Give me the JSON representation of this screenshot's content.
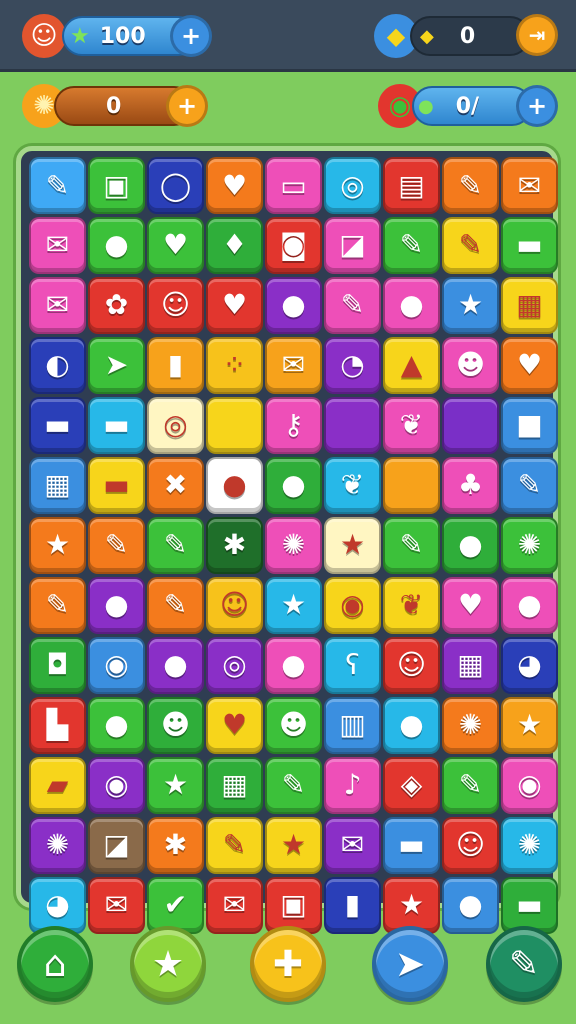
{
  "hud": {
    "coins_value": "100",
    "gems_value": "0",
    "energy_value": "0",
    "moves_value": "0/",
    "plus_label": "+"
  },
  "colors": {
    "topbar": "#3a4a5c",
    "background": "#7fcc5e",
    "board": "#2f3d52"
  },
  "bottom_bar": [
    {
      "name": "home-button",
      "icon": "home-icon",
      "glyph": "⌂",
      "color": "#2fae3a"
    },
    {
      "name": "star-button",
      "icon": "star-icon",
      "glyph": "★",
      "color": "#8fd63c"
    },
    {
      "name": "puzzle-button",
      "icon": "puzzle-icon",
      "glyph": "✚",
      "color": "#f7c21b"
    },
    {
      "name": "play-button",
      "icon": "play-icon",
      "glyph": "➤",
      "color": "#3b8fe0"
    },
    {
      "name": "edit-button",
      "icon": "pencil-icon",
      "glyph": "✎",
      "color": "#1f8f63"
    }
  ],
  "board": {
    "rows": [
      [
        [
          "#3fa9f5",
          "pencil-icon",
          "✎"
        ],
        [
          "#3cc13a",
          "bag-icon",
          "▣"
        ],
        [
          "#2a3fb8",
          "chat-icon",
          "◯"
        ],
        [
          "#f47a1c",
          "heart-icon",
          "♥"
        ],
        [
          "#ee4fb8",
          "card-icon",
          "▭"
        ],
        [
          "#27b8e8",
          "ring-icon",
          "◎"
        ],
        [
          "#e2362e",
          "window-icon",
          "▤"
        ],
        [
          "#f47a1c",
          "pencil-icon",
          "✎"
        ],
        [
          "#f47a1c",
          "mail-icon",
          "✉"
        ]
      ],
      [
        [
          "#ee4fb8",
          "mail-icon",
          "✉"
        ],
        [
          "#3cc13a",
          "berry-icon",
          "●"
        ],
        [
          "#3cc13a",
          "heart-icon",
          "♥"
        ],
        [
          "#2fae3a",
          "drop-icon",
          "♦"
        ],
        [
          "#e2362e",
          "camera-icon",
          "◙"
        ],
        [
          "#ee4fb8",
          "note-icon",
          "◪"
        ],
        [
          "#3cc13a",
          "pencil-icon",
          "✎"
        ],
        [
          "#f7d51b",
          "pencil-icon",
          "✎"
        ],
        [
          "#3cc13a",
          "book-icon",
          "▬"
        ]
      ],
      [
        [
          "#ee4fb8",
          "mail-icon",
          "✉"
        ],
        [
          "#e2362e",
          "flower-icon",
          "✿"
        ],
        [
          "#e2362e",
          "face-icon",
          "☺"
        ],
        [
          "#e2362e",
          "heart-icon",
          "♥"
        ],
        [
          "#8a2fc7",
          "fish-icon",
          "●"
        ],
        [
          "#ee4fb8",
          "brush-icon",
          "✎"
        ],
        [
          "#ee4fb8",
          "balloon-icon",
          "●"
        ],
        [
          "#3b8fe0",
          "star-icon",
          "★"
        ],
        [
          "#f7d51b",
          "ticket-icon",
          "▦"
        ]
      ],
      [
        [
          "#2a3fb8",
          "ball-icon",
          "◐"
        ],
        [
          "#3cc13a",
          "bird-icon",
          "➤"
        ],
        [
          "#f7a21b",
          "bag-icon",
          "▮"
        ],
        [
          "#f7c21b",
          "cookie-icon",
          "⁘"
        ],
        [
          "#f7a21b",
          "envelope-icon",
          "✉"
        ],
        [
          "#8a2fc7",
          "chat-icon",
          "◔"
        ],
        [
          "#f7d51b",
          "bottle-icon",
          "▲"
        ],
        [
          "#ee4fb8",
          "monster-icon",
          "☻"
        ],
        [
          "#f47a1c",
          "heart-icon",
          "♥"
        ]
      ],
      [
        [
          "#2a3fb8",
          "card-icon",
          "▬"
        ],
        [
          "#27b8e8",
          "card-icon",
          "▬"
        ],
        [
          "#fff6c2",
          "camera-icon",
          "◎"
        ],
        [
          "#f7d51b",
          "blank-icon",
          ""
        ],
        [
          "#ee4fb8",
          "key-icon",
          "⚷"
        ],
        [
          "#8a2fc7",
          "blank-icon",
          ""
        ],
        [
          "#ee4fb8",
          "leaf-icon",
          "❦"
        ],
        [
          "#7a2fc7",
          "blank-icon",
          ""
        ],
        [
          "#3b8fe0",
          "square-icon",
          "■"
        ]
      ],
      [
        [
          "#3b8fe0",
          "panel-icon",
          "▦"
        ],
        [
          "#f7d51b",
          "card-icon",
          "▬"
        ],
        [
          "#f47a1c",
          "bandage-icon",
          "✖"
        ],
        [
          "#ffffff",
          "fish-icon",
          "●"
        ],
        [
          "#2fae3a",
          "berry-icon",
          "●"
        ],
        [
          "#27b8e8",
          "leaf-icon",
          "❦"
        ],
        [
          "#f7a21b",
          "blank-icon",
          ""
        ],
        [
          "#ee4fb8",
          "sprout-icon",
          "♣"
        ],
        [
          "#3b8fe0",
          "pencil-icon",
          "✎"
        ]
      ],
      [
        [
          "#f47a1c",
          "star-icon",
          "★"
        ],
        [
          "#f47a1c",
          "pencil-icon",
          "✎"
        ],
        [
          "#3cc13a",
          "brush-icon",
          "✎"
        ],
        [
          "#1f6f2a",
          "bug-icon",
          "✱"
        ],
        [
          "#ee4fb8",
          "gear-icon",
          "✺"
        ],
        [
          "#fff6c2",
          "star-icon",
          "★"
        ],
        [
          "#3cc13a",
          "pencil-icon",
          "✎"
        ],
        [
          "#2fae3a",
          "berry-icon",
          "●"
        ],
        [
          "#3cc13a",
          "gear-icon",
          "✺"
        ]
      ],
      [
        [
          "#f47a1c",
          "pencil-icon",
          "✎"
        ],
        [
          "#8a2fc7",
          "apple-icon",
          "●"
        ],
        [
          "#f47a1c",
          "pencil-icon",
          "✎"
        ],
        [
          "#f7c21b",
          "face-icon",
          "☺"
        ],
        [
          "#27b8e8",
          "star-icon",
          "★"
        ],
        [
          "#f7d51b",
          "pin-icon",
          "◉"
        ],
        [
          "#f7d51b",
          "leaf-icon",
          "❦"
        ],
        [
          "#ee4fb8",
          "heart-icon",
          "♥"
        ],
        [
          "#ee4fb8",
          "apple-icon",
          "●"
        ]
      ],
      [
        [
          "#2fae3a",
          "lock-icon",
          "◘"
        ],
        [
          "#3b8fe0",
          "pin-icon",
          "◉"
        ],
        [
          "#8a2fc7",
          "ball-icon",
          "●"
        ],
        [
          "#8a2fc7",
          "ring-icon",
          "◎"
        ],
        [
          "#ee4fb8",
          "balloon-icon",
          "●"
        ],
        [
          "#27b8e8",
          "hook-icon",
          "ʕ"
        ],
        [
          "#e2362e",
          "face-icon",
          "☺"
        ],
        [
          "#8a2fc7",
          "grid-icon",
          "▦"
        ],
        [
          "#2a3fb8",
          "chat-icon",
          "◕"
        ]
      ],
      [
        [
          "#e2362e",
          "cup-icon",
          "▙"
        ],
        [
          "#3cc13a",
          "bird-icon",
          "●"
        ],
        [
          "#2fae3a",
          "monster-icon",
          "☻"
        ],
        [
          "#f7d51b",
          "heart-icon",
          "♥"
        ],
        [
          "#3cc13a",
          "panda-icon",
          "☻"
        ],
        [
          "#3b8fe0",
          "chart-icon",
          "▥"
        ],
        [
          "#27b8e8",
          "fish-icon",
          "●"
        ],
        [
          "#f47a1c",
          "sun-icon",
          "✺"
        ],
        [
          "#f7a21b",
          "star-icon",
          "★"
        ]
      ],
      [
        [
          "#f7d51b",
          "folder-icon",
          "▰"
        ],
        [
          "#8a2fc7",
          "badge-icon",
          "◉"
        ],
        [
          "#3cc13a",
          "star-icon",
          "★"
        ],
        [
          "#2fae3a",
          "chip-icon",
          "▦"
        ],
        [
          "#3cc13a",
          "bandage-icon",
          "✎"
        ],
        [
          "#ee4fb8",
          "guitar-icon",
          "♪"
        ],
        [
          "#e2362e",
          "box-icon",
          "◈"
        ],
        [
          "#3cc13a",
          "candy-icon",
          "✎"
        ],
        [
          "#ee4fb8",
          "pin-icon",
          "◉"
        ]
      ],
      [
        [
          "#8a2fc7",
          "gear-icon",
          "✺"
        ],
        [
          "#8a6a4a",
          "note-icon",
          "◪"
        ],
        [
          "#f47a1c",
          "bug-icon",
          "✱"
        ],
        [
          "#f7d51b",
          "brush-icon",
          "✎"
        ],
        [
          "#f7d51b",
          "star-icon",
          "★"
        ],
        [
          "#8a2fc7",
          "envelope-icon",
          "✉"
        ],
        [
          "#3b8fe0",
          "card-icon",
          "▬"
        ],
        [
          "#e2362e",
          "face-icon",
          "☺"
        ],
        [
          "#27b8e8",
          "gear-icon",
          "✺"
        ]
      ],
      [
        [
          "#27b8e8",
          "chat-icon",
          "◕"
        ],
        [
          "#e2362e",
          "mail-icon",
          "✉"
        ],
        [
          "#3cc13a",
          "check-icon",
          "✔"
        ],
        [
          "#e2362e",
          "envelope-icon",
          "✉"
        ],
        [
          "#e2362e",
          "wallet-icon",
          "▣"
        ],
        [
          "#2a3fb8",
          "battery-icon",
          "▮"
        ],
        [
          "#e2362e",
          "star-icon",
          "★"
        ],
        [
          "#3b8fe0",
          "cookie-icon",
          "●"
        ],
        [
          "#2fae3a",
          "card-icon",
          "▬"
        ]
      ]
    ]
  }
}
